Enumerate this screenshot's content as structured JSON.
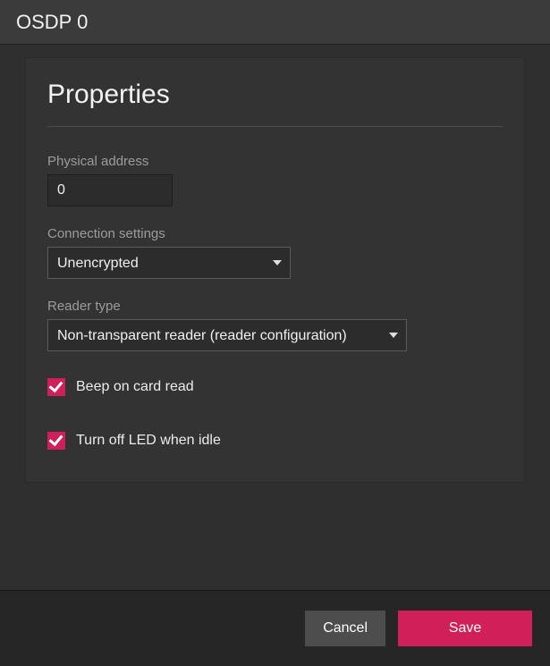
{
  "window": {
    "title": "OSDP 0"
  },
  "panel": {
    "heading": "Properties"
  },
  "fields": {
    "physical_address": {
      "label": "Physical address",
      "value": "0"
    },
    "connection_settings": {
      "label": "Connection settings",
      "value": "Unencrypted"
    },
    "reader_type": {
      "label": "Reader type",
      "value": "Non-transparent reader (reader configuration)"
    }
  },
  "checks": {
    "beep": {
      "label": "Beep on card read",
      "checked": true
    },
    "led": {
      "label": "Turn off LED when idle",
      "checked": true
    }
  },
  "footer": {
    "cancel": "Cancel",
    "save": "Save"
  },
  "colors": {
    "accent": "#d01f59"
  }
}
